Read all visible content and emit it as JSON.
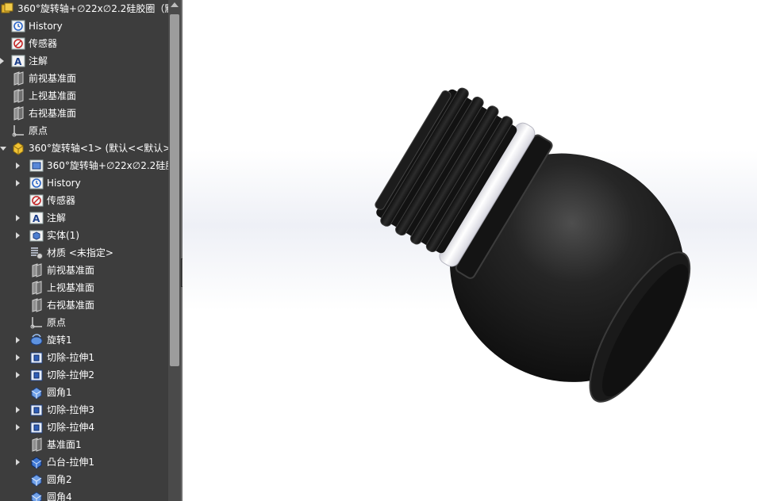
{
  "feature_tree": {
    "root_title": "360°旋转轴+∅22x∅2.2硅胶圈（默认",
    "items": [
      {
        "label": "History",
        "icon": "history-icon",
        "level": 0,
        "expander": "none"
      },
      {
        "label": "传感器",
        "icon": "sensor-icon",
        "level": 0,
        "expander": "none"
      },
      {
        "label": "注解",
        "icon": "annotations-icon",
        "level": 0,
        "expander": "closed"
      },
      {
        "label": "前视基准面",
        "icon": "plane-icon",
        "level": 0,
        "expander": "none"
      },
      {
        "label": "上视基准面",
        "icon": "plane-icon",
        "level": 0,
        "expander": "none"
      },
      {
        "label": "右视基准面",
        "icon": "plane-icon",
        "level": 0,
        "expander": "none"
      },
      {
        "label": "原点",
        "icon": "origin-icon",
        "level": 0,
        "expander": "none"
      },
      {
        "label": "360°旋转轴<1> (默认<<默认>_",
        "icon": "part-component-icon",
        "level": 0,
        "expander": "open"
      },
      {
        "label": "360°旋转轴+∅22x∅2.2硅胶",
        "icon": "component-folder-icon",
        "level": 1,
        "expander": "closed"
      },
      {
        "label": "History",
        "icon": "history-icon",
        "level": 1,
        "expander": "closed"
      },
      {
        "label": "传感器",
        "icon": "sensor-icon",
        "level": 1,
        "expander": "none"
      },
      {
        "label": "注解",
        "icon": "annotations-icon",
        "level": 1,
        "expander": "closed"
      },
      {
        "label": "实体(1)",
        "icon": "solid-body-icon",
        "level": 1,
        "expander": "closed"
      },
      {
        "label": "材质 <未指定>",
        "icon": "material-icon",
        "level": 1,
        "expander": "none"
      },
      {
        "label": "前视基准面",
        "icon": "plane-icon",
        "level": 1,
        "expander": "none"
      },
      {
        "label": "上视基准面",
        "icon": "plane-icon",
        "level": 1,
        "expander": "none"
      },
      {
        "label": "右视基准面",
        "icon": "plane-icon",
        "level": 1,
        "expander": "none"
      },
      {
        "label": "原点",
        "icon": "origin-icon",
        "level": 1,
        "expander": "none"
      },
      {
        "label": "旋转1",
        "icon": "revolve-icon",
        "level": 1,
        "expander": "closed"
      },
      {
        "label": "切除-拉伸1",
        "icon": "cut-extrude-icon",
        "level": 1,
        "expander": "closed"
      },
      {
        "label": "切除-拉伸2",
        "icon": "cut-extrude-icon",
        "level": 1,
        "expander": "closed"
      },
      {
        "label": "圆角1",
        "icon": "fillet-icon",
        "level": 1,
        "expander": "none"
      },
      {
        "label": "切除-拉伸3",
        "icon": "cut-extrude-icon",
        "level": 1,
        "expander": "closed"
      },
      {
        "label": "切除-拉伸4",
        "icon": "cut-extrude-icon",
        "level": 1,
        "expander": "closed"
      },
      {
        "label": "基准面1",
        "icon": "plane-icon",
        "level": 1,
        "expander": "none"
      },
      {
        "label": "凸台-拉伸1",
        "icon": "boss-extrude-icon",
        "level": 1,
        "expander": "closed"
      },
      {
        "label": "圆角2",
        "icon": "fillet-icon",
        "level": 1,
        "expander": "none"
      },
      {
        "label": "圆角4",
        "icon": "fillet-icon",
        "level": 1,
        "expander": "none"
      }
    ]
  },
  "colors": {
    "panel_bg": "#3d3d3d",
    "text": "#ffffff",
    "model": "#1e1e1e",
    "seal_ring": "#f4f4f8"
  }
}
